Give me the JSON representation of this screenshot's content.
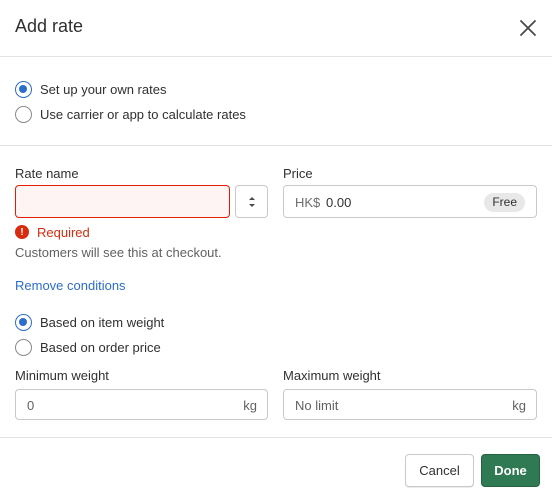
{
  "dialog": {
    "title": "Add rate",
    "close_icon": "close-icon"
  },
  "rate_source": {
    "options": [
      {
        "label": "Set up your own rates",
        "checked": true
      },
      {
        "label": "Use carrier or app to calculate rates",
        "checked": false
      }
    ]
  },
  "rate_name": {
    "label": "Rate name",
    "value": "",
    "error": "Required",
    "error_icon": "alert-circle-icon",
    "help_text": "Customers will see this at checkout.",
    "stepper_icon": "select-chevrons-icon"
  },
  "price": {
    "label": "Price",
    "prefix": "HK$",
    "value": "0.00",
    "badge": "Free"
  },
  "conditions": {
    "remove_link": "Remove conditions",
    "options": [
      {
        "label": "Based on item weight",
        "checked": true
      },
      {
        "label": "Based on order price",
        "checked": false
      }
    ]
  },
  "min_weight": {
    "label": "Minimum weight",
    "placeholder": "0",
    "unit": "kg"
  },
  "max_weight": {
    "label": "Maximum weight",
    "placeholder": "No limit",
    "unit": "kg"
  },
  "footer": {
    "cancel_label": "Cancel",
    "done_label": "Done"
  },
  "colors": {
    "primary": "#2f7a53",
    "link": "#2c6ecb",
    "error": "#d72c0d",
    "radio_checked": "#2c6ecb"
  }
}
